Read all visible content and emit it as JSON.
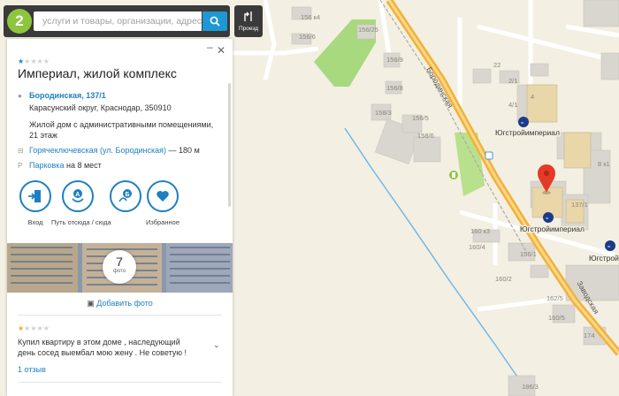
{
  "search": {
    "logo": "2",
    "placeholder": "услуги и товары, организации, адреса",
    "route_label": "Проезд"
  },
  "card": {
    "rating_stars": [
      true,
      false,
      false,
      false,
      false
    ],
    "title": "Империал, жилой комплекс",
    "address_link": "Бородинская, 137/1",
    "address_rest": "Карасунский округ, Краснодар, 350910",
    "description_line1": "Жилой дом с административными помещениями,",
    "description_line2": "21 этаж",
    "stop_link": "Горячеключевская (ул. Бородинская)",
    "stop_distance": "— 180 м",
    "parking_link": "Парковка",
    "parking_rest": "на 8 мест",
    "actions": [
      {
        "label": "Вход",
        "icon": "entrance-icon"
      },
      {
        "label": "Путь отсюда / сюда",
        "icon": "route-ab-icon"
      },
      {
        "label": "Маршрут",
        "icon": "route-icon"
      },
      {
        "label": "Избранное",
        "icon": "heart-icon"
      }
    ],
    "photo_count": "7",
    "photo_caption": "фото",
    "add_photo": "Добавить фото",
    "review": {
      "stars": [
        true,
        false,
        false,
        false,
        false
      ],
      "line1": "Купил квартиру в этом доме , наследующий",
      "line2": "день сосед выембал мою жену . Не советую !",
      "count": "1 отзыв"
    }
  },
  "map": {
    "streets": [
      "Бородинская",
      "Заводская"
    ],
    "pois": [
      "Югстройимпериал",
      "Югстройимпериал",
      "Югстройимп"
    ],
    "house_numbers": [
      "156 к4",
      "156/6",
      "156/25",
      "156/9",
      "22",
      "156/8",
      "2/1",
      "4",
      "158/3",
      "156/5",
      "4/1",
      "158/6",
      "8 к1",
      "137/1",
      "160 к3",
      "160/4",
      "156/1",
      "160/2",
      "162/5",
      "160/5",
      "174",
      "186/3"
    ],
    "colors": {
      "background": "#f3efe2",
      "main_road": "#f2b13a",
      "green": "#a8d97f",
      "building": "#d9d6cf",
      "water": "#6fb7e8",
      "marker": "#e53a25",
      "accent": "#1e7fc2"
    }
  }
}
